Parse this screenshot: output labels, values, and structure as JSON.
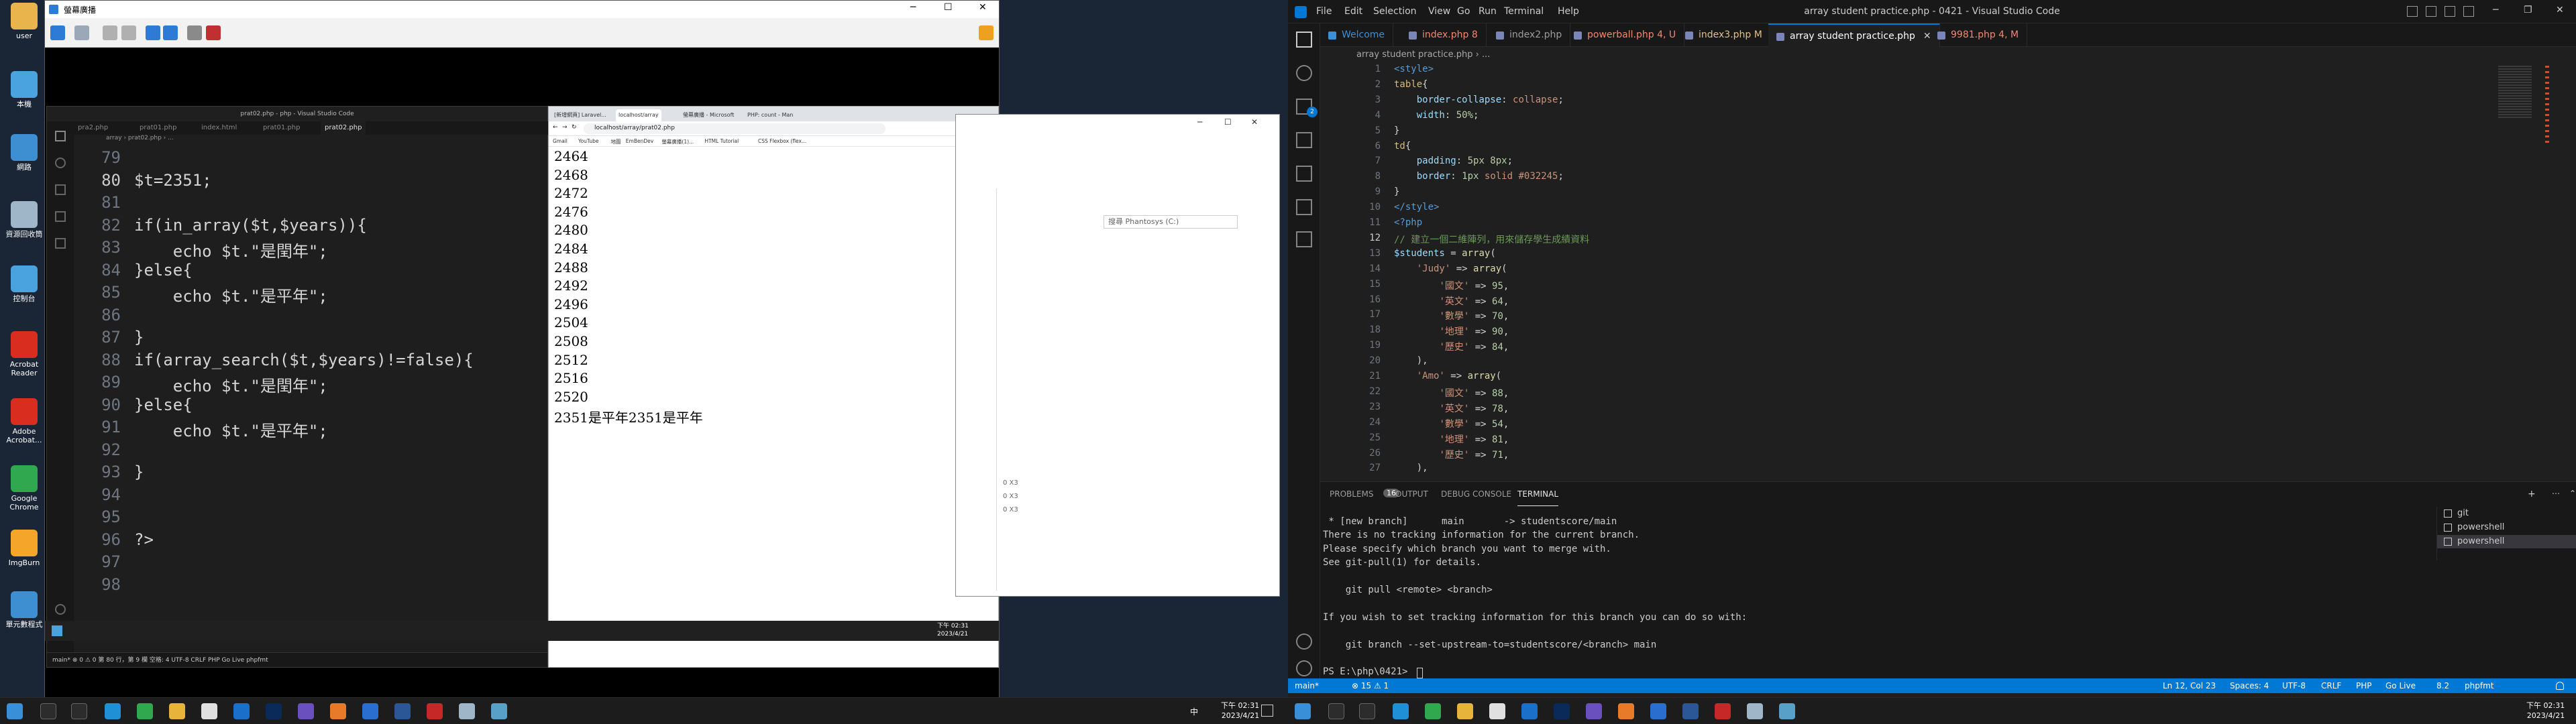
{
  "desktop": {
    "icons": [
      {
        "label": "user",
        "color": "#e9b44c"
      },
      {
        "label": "本機",
        "color": "#4aa3df"
      },
      {
        "label": "網路",
        "color": "#3d8fd1"
      },
      {
        "label": "資源回收筒",
        "color": "#9fb6c8"
      },
      {
        "label": "控制台",
        "color": "#4aa3df"
      },
      {
        "label": "Acrobat Reader",
        "color": "#d92d20"
      },
      {
        "label": "Adobe Acrobat...",
        "color": "#d92d20"
      },
      {
        "label": "Google Chrome",
        "color": "#2fa84f"
      },
      {
        "label": "ImgBurn",
        "color": "#f4a52a"
      },
      {
        "label": "單元數程式",
        "color": "#3d8fd1"
      }
    ]
  },
  "remote": {
    "title": "螢幕廣播",
    "clock": "下午 02:31\n2023/4/21"
  },
  "inner_vscode": {
    "title": "prat02.php - php - Visual Studio Code",
    "tabs": [
      "pra2.php",
      "prat01.php",
      "index.html",
      "prat01.php",
      "prat02.php"
    ],
    "breadcrumb": "array › prat02.php › ...",
    "lines": [
      {
        "n": "79",
        "t": ""
      },
      {
        "n": "80",
        "t": "$t=2351;"
      },
      {
        "n": "81",
        "t": ""
      },
      {
        "n": "82",
        "t": "if(in_array($t,$years)){"
      },
      {
        "n": "83",
        "t": "    echo $t.\"是閏年\";"
      },
      {
        "n": "84",
        "t": "}else{"
      },
      {
        "n": "85",
        "t": "    echo $t.\"是平年\";"
      },
      {
        "n": "86",
        "t": ""
      },
      {
        "n": "87",
        "t": "}"
      },
      {
        "n": "88",
        "t": "if(array_search($t,$years)!=false){"
      },
      {
        "n": "89",
        "t": "    echo $t.\"是閏年\";"
      },
      {
        "n": "90",
        "t": "}else{"
      },
      {
        "n": "91",
        "t": "    echo $t.\"是平年\";"
      },
      {
        "n": "92",
        "t": ""
      },
      {
        "n": "93",
        "t": "}"
      },
      {
        "n": "94",
        "t": ""
      },
      {
        "n": "95",
        "t": ""
      },
      {
        "n": "96",
        "t": "?>"
      },
      {
        "n": "97",
        "t": ""
      },
      {
        "n": "98",
        "t": ""
      }
    ],
    "status": "main* ⊗ 0 ⚠ 0    第 80 行，第 9 欄  空格: 4  UTF-8  CRLF  PHP  Go Live  phpfmt"
  },
  "inner_browser": {
    "tabs": [
      "[新增網頁] Laravel...",
      "localhost/array",
      "螢幕廣播 - Microsoft",
      "PHP: count - Man"
    ],
    "url": "localhost/array/prat02.php",
    "bookmarks": [
      "Gmail",
      "YouTube",
      "地圖",
      "EmBenDev",
      "螢幕廣播(1)...",
      "HTML Tutorial",
      "CSS Flexbox (flex..."
    ],
    "years": [
      "2464",
      "2468",
      "2472",
      "2476",
      "2480",
      "2484",
      "2488",
      "2492",
      "2496",
      "2504",
      "2508",
      "2512",
      "2516",
      "2520"
    ],
    "result": "2351是平年2351是平年"
  },
  "explorer": {
    "search_placeholder": "搜尋 Phantosys (C:)",
    "side_values": [
      "0 X3",
      "0 X3",
      "0 X3"
    ]
  },
  "host_taskbar": {
    "clock_time": "下午 02:31",
    "clock_date": "2023/4/21",
    "lang": "中"
  },
  "vscode": {
    "title": "array student practice.php - 0421 - Visual Studio Code",
    "menu": [
      "File",
      "Edit",
      "Selection",
      "View",
      "Go",
      "Run",
      "Terminal",
      "Help"
    ],
    "tabs": [
      {
        "label": "Welcome",
        "color": "#3c8fd6"
      },
      {
        "label": "index.php 8",
        "color": "#f48771"
      },
      {
        "label": "index2.php",
        "color": "#9d9d9d"
      },
      {
        "label": "powerball.php 4, U",
        "color": "#f48771"
      },
      {
        "label": "index3.php M",
        "color": "#e2c08d"
      },
      {
        "label": "array student practice.php",
        "color": "#ffffff"
      },
      {
        "label": "9981.php 4, M",
        "color": "#f48771"
      }
    ],
    "breadcrumb": "array student practice.php › ...",
    "lines": [
      {
        "n": "1",
        "h": "<span class=\"tag\">&lt;style&gt;</span>"
      },
      {
        "n": "2",
        "h": "<span class=\"sel\">table</span>{"
      },
      {
        "n": "3",
        "h": "    <span class=\"prop\">border-collapse</span>: <span class=\"str\">collapse</span>;"
      },
      {
        "n": "4",
        "h": "    <span class=\"prop\">width</span>: <span class=\"num\">50%</span>;"
      },
      {
        "n": "5",
        "h": "}"
      },
      {
        "n": "6",
        "h": "<span class=\"sel\">td</span>{"
      },
      {
        "n": "7",
        "h": "    <span class=\"prop\">padding</span>: <span class=\"num\">5px 8px</span>;"
      },
      {
        "n": "8",
        "h": "    <span class=\"prop\">border</span>: <span class=\"num\">1px</span> <span class=\"str\">solid</span> <span class=\"str\">#032245</span>;"
      },
      {
        "n": "9",
        "h": "}"
      },
      {
        "n": "10",
        "h": "<span class=\"tag\">&lt;/style&gt;</span>"
      },
      {
        "n": "11",
        "h": "<span class=\"php\">&lt;?php</span>"
      },
      {
        "n": "12",
        "h": "<span class=\"cmt\">// 建立一個二維陣列，用來儲存學生成績資料</span>"
      },
      {
        "n": "13",
        "h": "<span class=\"var\">$students</span> = <span class=\"fn\">array</span>("
      },
      {
        "n": "14",
        "h": "    <span class=\"str\">'Judy'</span> =&gt; <span class=\"fn\">array</span>("
      },
      {
        "n": "15",
        "h": "        <span class=\"str\">'國文'</span> =&gt; <span class=\"num\">95</span>,"
      },
      {
        "n": "16",
        "h": "        <span class=\"str\">'英文'</span> =&gt; <span class=\"num\">64</span>,"
      },
      {
        "n": "17",
        "h": "        <span class=\"str\">'數學'</span> =&gt; <span class=\"num\">70</span>,"
      },
      {
        "n": "18",
        "h": "        <span class=\"str\">'地理'</span> =&gt; <span class=\"num\">90</span>,"
      },
      {
        "n": "19",
        "h": "        <span class=\"str\">'歷史'</span> =&gt; <span class=\"num\">84</span>,"
      },
      {
        "n": "20",
        "h": "    ),"
      },
      {
        "n": "21",
        "h": "    <span class=\"str\">'Amo'</span> =&gt; <span class=\"fn\">array</span>("
      },
      {
        "n": "22",
        "h": "        <span class=\"str\">'國文'</span> =&gt; <span class=\"num\">88</span>,"
      },
      {
        "n": "23",
        "h": "        <span class=\"str\">'英文'</span> =&gt; <span class=\"num\">78</span>,"
      },
      {
        "n": "24",
        "h": "        <span class=\"str\">'數學'</span> =&gt; <span class=\"num\">54</span>,"
      },
      {
        "n": "25",
        "h": "        <span class=\"str\">'地理'</span> =&gt; <span class=\"num\">81</span>,"
      },
      {
        "n": "26",
        "h": "        <span class=\"str\">'歷史'</span> =&gt; <span class=\"num\">71</span>,"
      },
      {
        "n": "27",
        "h": "    ),"
      }
    ],
    "panel_tabs": [
      "PROBLEMS",
      "OUTPUT",
      "DEBUG CONSOLE",
      "TERMINAL"
    ],
    "problems_count": "16",
    "terminal_lines": [
      " * [new branch]      main       -> studentscore/main",
      "There is no tracking information for the current branch.",
      "Please specify which branch you want to merge with.",
      "See git-pull(1) for details.",
      "",
      "    git pull <remote> <branch>",
      "",
      "If you wish to set tracking information for this branch you can do so with:",
      "",
      "    git branch --set-upstream-to=studentscore/<branch> main",
      "",
      "PS E:\\php\\0421> "
    ],
    "terminals": [
      "git",
      "powershell",
      "powershell"
    ],
    "status_left": [
      "main*",
      "⊗ 15 ⚠ 1"
    ],
    "status_right": [
      "Ln 12, Col 23",
      "Spaces: 4",
      "UTF-8",
      "CRLF",
      "PHP",
      "Go Live",
      "8.2",
      "phpfmt"
    ],
    "clock_time": "下午 02:31",
    "clock_date": "2023/4/21"
  }
}
